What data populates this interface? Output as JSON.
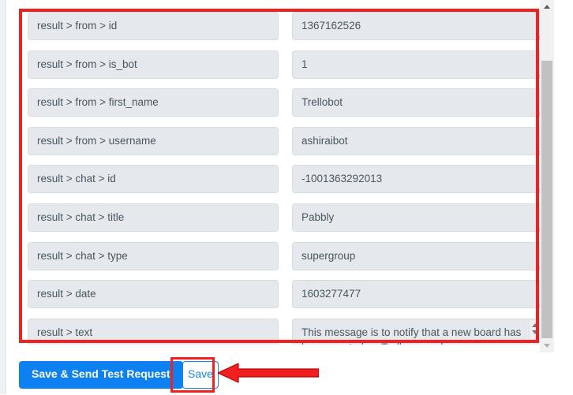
{
  "app": {
    "accent_blue": "#0d80f2",
    "annotation_red": "#f02020",
    "field_bg": "#e5e9ed"
  },
  "mapping_fields": [
    {
      "label": "result > from > id",
      "value": "1367162526",
      "multiline": false
    },
    {
      "label": "result > from > is_bot",
      "value": "1",
      "multiline": false
    },
    {
      "label": "result > from > first_name",
      "value": "Trellobot",
      "multiline": false
    },
    {
      "label": "result > from > username",
      "value": "ashiraibot",
      "multiline": false
    },
    {
      "label": "result > chat > id",
      "value": "-1001363292013",
      "multiline": false
    },
    {
      "label": "result > chat > title",
      "value": "Pabbly",
      "multiline": false
    },
    {
      "label": "result > chat > type",
      "value": "supergroup",
      "multiline": false
    },
    {
      "label": "result > date",
      "value": "1603277477",
      "multiline": false
    },
    {
      "label": "result > text",
      "value": "This message is to notify that a new board has been created on Trello named",
      "multiline": true
    }
  ],
  "footer": {
    "save_send_label": "Save & Send Test Request",
    "save_label": "Save"
  },
  "annotations": {
    "field_list_highlight": "red-rectangle-around-response-fields",
    "save_highlight": "red-rectangle-around-save-button",
    "save_pointer": "red-left-arrow-pointing-to-save-button"
  },
  "scrollbars": {
    "page_up_arrow": "scroll-up-arrow",
    "page_down_arrow": "scroll-down-arrow",
    "textarea_up_arrow": "textarea-scroll-up-arrow",
    "textarea_down_arrow": "textarea-scroll-down-arrow"
  }
}
